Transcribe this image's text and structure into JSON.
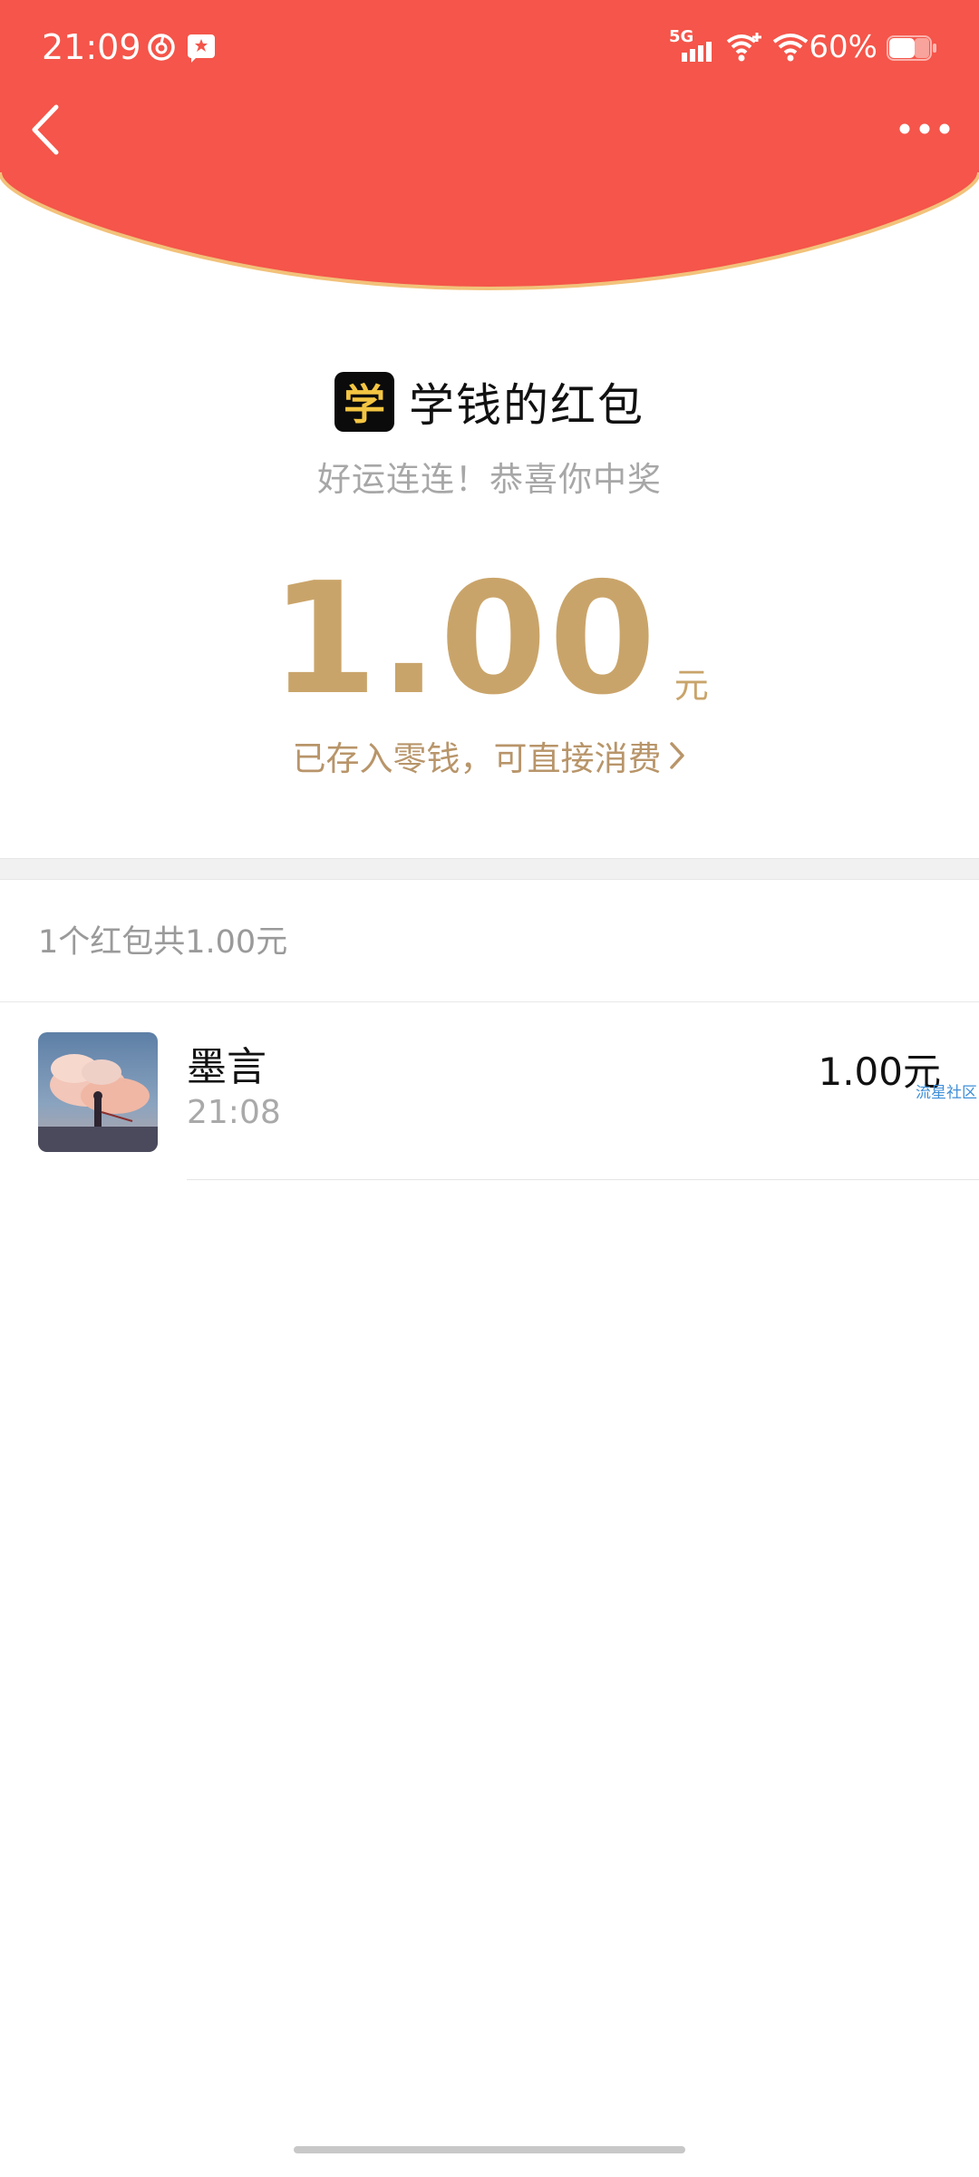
{
  "status_bar": {
    "time": "21:09",
    "battery_percent": "60%",
    "network": "5G",
    "icons": [
      "netease-music-icon",
      "notification-flag-icon",
      "signal-5g-icon",
      "wifi-plus-icon",
      "wifi-icon",
      "battery-icon"
    ]
  },
  "nav": {
    "back_icon": "chevron-left-icon",
    "more_icon": "more-dots-icon"
  },
  "sender": {
    "avatar_char": "学",
    "title": "学钱的红包",
    "blessing": "好运连连！恭喜你中奖"
  },
  "amount": {
    "value": "1.00",
    "unit": "元",
    "saved_note": "已存入零钱，可直接消费"
  },
  "summary": {
    "text": "1个红包共1.00元"
  },
  "records": [
    {
      "name": "墨言",
      "time": "21:08",
      "amount": "1.00元",
      "watermark": "流星社区"
    }
  ],
  "colors": {
    "header_red": "#F5554A",
    "header_border": "#F2C27A",
    "gold_amount": "#C9A46A",
    "gold_note": "#B8956A",
    "watermark_blue": "#3F8FD8"
  }
}
